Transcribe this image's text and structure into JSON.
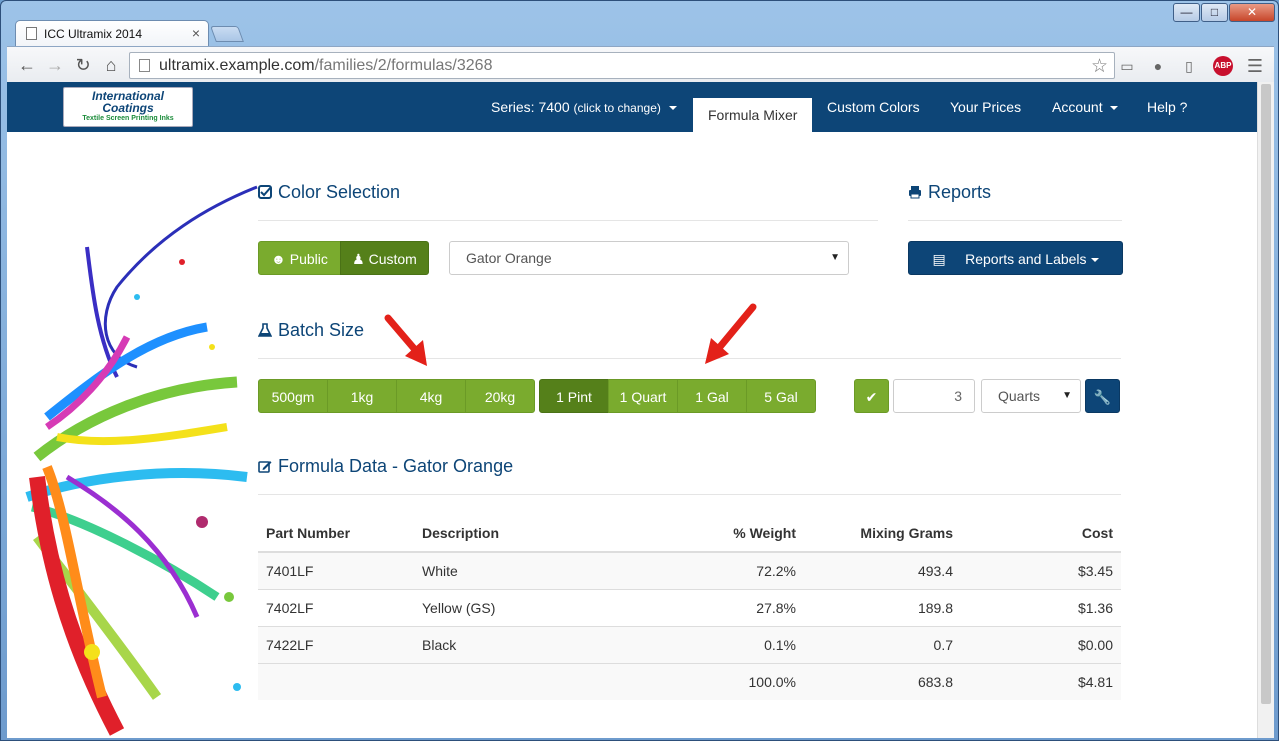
{
  "browser": {
    "tab_title": "ICC Ultramix 2014",
    "tab_close": "×",
    "url_host": "ultramix.example.com",
    "url_path": "/families/2/formulas/3268",
    "abp_label": "ABP"
  },
  "navbar": {
    "logo_line1": "International",
    "logo_line2": "Coatings",
    "logo_tagline": "Textile Screen Printing Inks",
    "series_label": "Series: 7400",
    "series_hint": "(click to change)",
    "formula_mixer": "Formula Mixer",
    "custom_colors": "Custom Colors",
    "your_prices": "Your Prices",
    "account": "Account",
    "help": "Help ?"
  },
  "color_selection": {
    "title": "Color Selection",
    "public_label": "Public",
    "custom_label": "Custom",
    "selected_color": "Gator Orange"
  },
  "reports": {
    "title": "Reports",
    "button_label": "Reports and Labels"
  },
  "batch_size": {
    "title": "Batch Size",
    "metric_options": [
      "500gm",
      "1kg",
      "4kg",
      "20kg"
    ],
    "volume_options": [
      "1 Pint",
      "1 Quart",
      "1 Gal",
      "5 Gal"
    ],
    "active_volume": "1 Pint",
    "custom_quantity": "3",
    "custom_unit": "Quarts"
  },
  "formula_data": {
    "title": "Formula Data - Gator Orange",
    "columns": [
      "Part Number",
      "Description",
      "% Weight",
      "Mixing Grams",
      "Cost"
    ],
    "rows": [
      {
        "part": "7401LF",
        "description": "White",
        "weight": "72.2%",
        "grams": "493.4",
        "cost": "$3.45"
      },
      {
        "part": "7402LF",
        "description": "Yellow (GS)",
        "weight": "27.8%",
        "grams": "189.8",
        "cost": "$1.36"
      },
      {
        "part": "7422LF",
        "description": "Black",
        "weight": "0.1%",
        "grams": "0.7",
        "cost": "$0.00"
      }
    ],
    "totals": {
      "weight": "100.0%",
      "grams": "683.8",
      "cost": "$4.81"
    }
  },
  "colors": {
    "brand_blue": "#0d4577",
    "button_green": "#7aab2e",
    "button_green_active": "#55801a",
    "annotation_red": "#e32119"
  }
}
